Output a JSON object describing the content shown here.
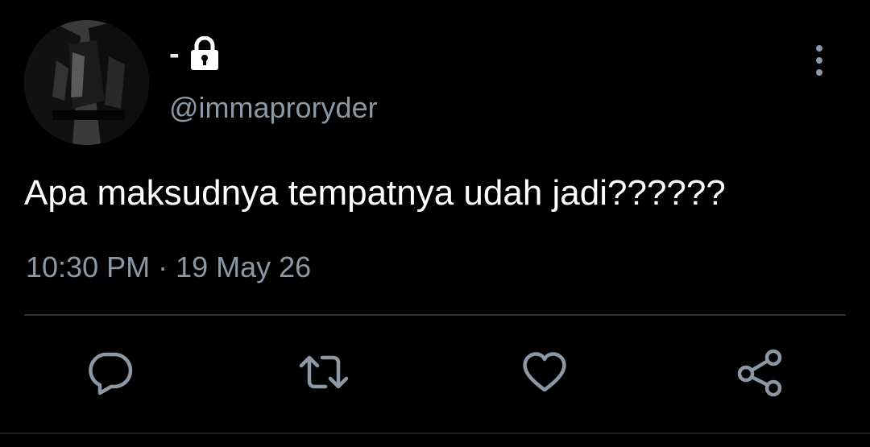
{
  "author": {
    "display_name": "-",
    "handle": "@immaproryder",
    "protected": true
  },
  "tweet": {
    "text": "Apa maksudnya tempatnya udah jadi??????",
    "time": "10:30 PM",
    "separator": "·",
    "date": "19 May 26"
  },
  "icons": {
    "lock": "lock-icon",
    "more": "more-vertical-icon",
    "reply": "reply-icon",
    "retweet": "retweet-icon",
    "like": "heart-icon",
    "share": "share-icon"
  },
  "colors": {
    "background": "#000000",
    "text_primary": "#ffffff",
    "text_secondary": "#8b98a5",
    "divider": "#2f3336"
  }
}
